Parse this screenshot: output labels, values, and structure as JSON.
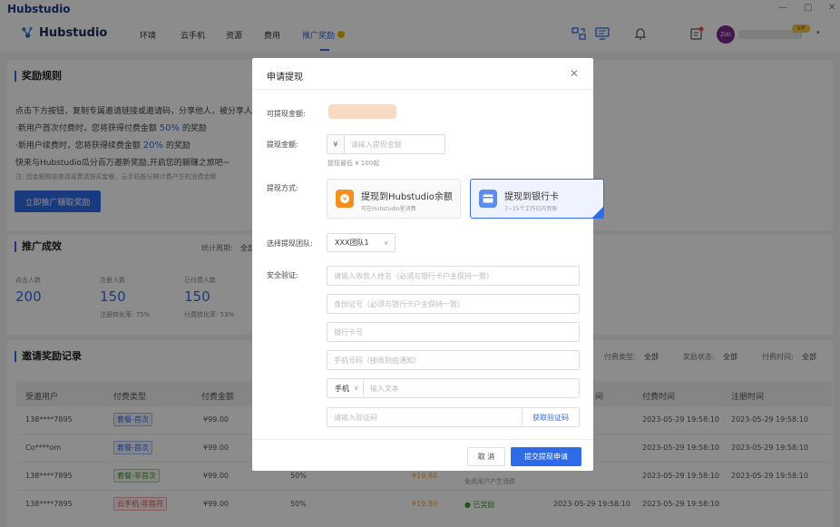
{
  "app": {
    "title": "Hubstudio",
    "window_controls": [
      "—",
      "□",
      "✕"
    ]
  },
  "nav": {
    "logo_text": "Hubstudio",
    "items": [
      "环境",
      "云手机",
      "资源",
      "费用",
      "推广奖励"
    ],
    "active_index": 4,
    "user": {
      "avatar_text": "ZIXI",
      "vip_badge": "VIP"
    }
  },
  "rules": {
    "title": "奖励规则",
    "line1": "点击下方按钮，复制专属邀请链接或邀请码，分享他人，被分享人",
    "line2_pre": "·新用户首次付费时，您将获得付费金额",
    "line2_pct": "50%",
    "line2_post": "的奖励",
    "line3_pre": "·新用户续费时，您将获得续费金额",
    "line3_pct": "20%",
    "line3_post": "的奖励",
    "line4": "快来与Hubstudio瓜分百万邀新奖励,开启您的躺赚之旅吧~",
    "note": "注: 因金额购收邀请返费请按买套餐，云手机按分摊计费产生的消费金额",
    "cta": "立即推广赚取奖励"
  },
  "effect": {
    "title": "推广成效",
    "period_label": "统计周期:",
    "period_value": "全部",
    "stats": [
      {
        "label": "点击人数",
        "value": "200",
        "sub": ""
      },
      {
        "label": "注册人数",
        "value": "150",
        "sub": "注册转化率: 75%"
      },
      {
        "label": "已付费人数",
        "value": "150",
        "sub": "付费转化率: 53%"
      }
    ]
  },
  "records": {
    "title": "邀请奖励记录",
    "filters": [
      {
        "label": "付费类型:",
        "value": "全部"
      },
      {
        "label": "奖励状态:",
        "value": "全部"
      },
      {
        "label": "付费时间:",
        "value": "全部"
      }
    ],
    "columns": [
      "受邀用户",
      "付费类型",
      "付费金额",
      "",
      "",
      "",
      "付费时间",
      "注册时间"
    ],
    "extra_col": "间",
    "rows": [
      {
        "user": "138****7895",
        "type": "套餐-首次",
        "amount": "¥99.00",
        "ratio": "",
        "reward": "",
        "status": "",
        "pay_time": "2023-05-29 19:58:10",
        "reg_time": "2023-05-29 19:58:10"
      },
      {
        "user": "Co****om",
        "type": "套餐-首次",
        "amount": "¥99.00",
        "ratio": "",
        "reward": "",
        "status": "",
        "pay_time": "2023-05-29 19:58:10",
        "reg_time": "2023-05-29 19:58:10"
      },
      {
        "user": "138****7895",
        "type": "套餐-非首次",
        "amount": "¥99.00",
        "ratio": "50%",
        "reward": "¥19.80",
        "status": "免退用户产生消费",
        "pay_time": "2023-05-29 19:58:10",
        "reg_time": "2023-05-29 19:58:10"
      },
      {
        "user": "138****7895",
        "type": "云手机-非首月",
        "amount": "¥99.00",
        "ratio": "50%",
        "reward": "¥19.80",
        "status": "● 已奖励",
        "pay_time": "2023-05-29 19:58:10",
        "reg_time": "2023-05-29 19:58:10"
      }
    ]
  },
  "modal": {
    "title": "申请提现",
    "available_label": "可提现金额:",
    "amount_label": "提现金额:",
    "currency": "¥",
    "amount_placeholder": "请输入提现金额",
    "min_hint": "提现最低 ¥ 100起",
    "method_label": "提现方式:",
    "methods": [
      {
        "title": "提现到Hubstudio余额",
        "desc": "可在Hubstudio里消费",
        "selected": false
      },
      {
        "title": "提现到银行卡",
        "desc": "7~15个工作日内到账",
        "selected": true
      }
    ],
    "team_label": "选择提现团队:",
    "team_value": "XXX团队1",
    "verify_label": "安全验证:",
    "name_placeholder": "请输入收款人姓名（必须与银行卡户主保持一致）",
    "id_placeholder": "身份证号（必须与银行卡户主保持一致）",
    "bank_placeholder": "银行卡号",
    "phone_placeholder": "手机号码（接收到底通知）",
    "contact_type": "手机",
    "contact_placeholder": "输入文本",
    "code_placeholder": "请输入验证码",
    "get_code": "获取验证码",
    "cancel": "取 消",
    "submit": "提交提现申请"
  },
  "colors": {
    "accent": "#2f6be8",
    "overlay": "rgba(0,0,0,0.45)"
  }
}
